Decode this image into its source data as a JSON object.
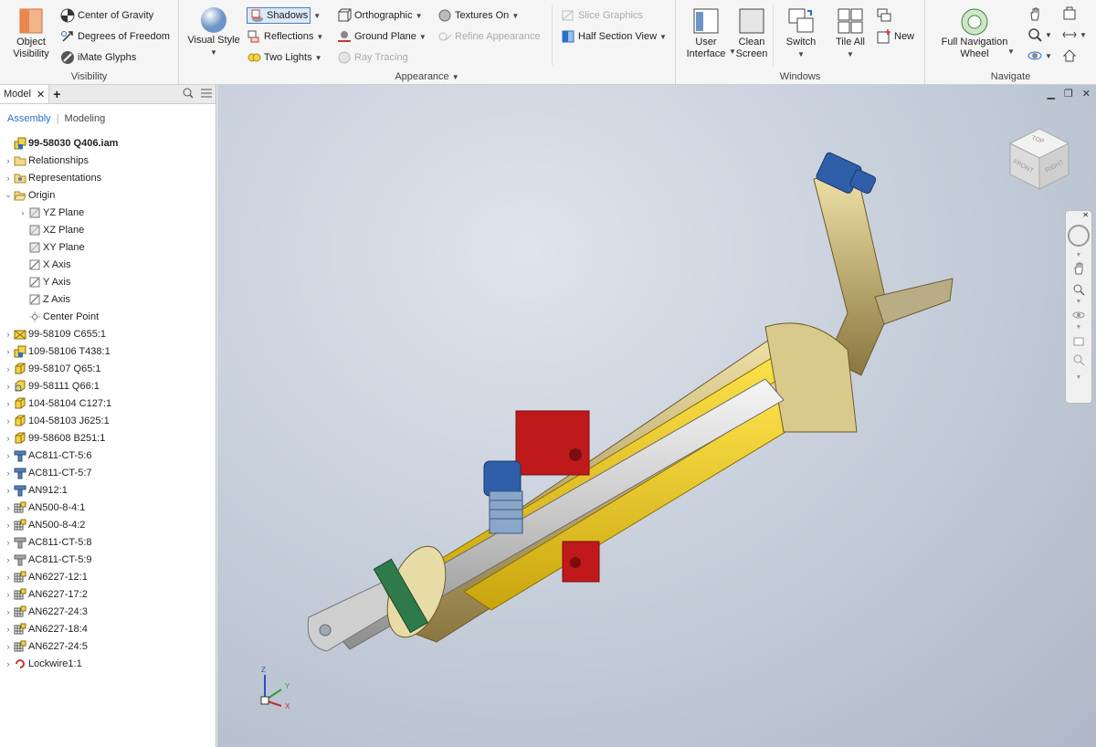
{
  "ribbon": {
    "visibility": {
      "object_visibility": "Object\nVisibility",
      "center_of_gravity": "Center of Gravity",
      "degrees_of_freedom": "Degrees of Freedom",
      "imate_glyphs": "iMate Glyphs",
      "label": "Visibility"
    },
    "appearance": {
      "visual_style": "Visual Style",
      "shadows": "Shadows",
      "reflections": "Reflections",
      "two_lights": "Two Lights",
      "orthographic": "Orthographic",
      "ground_plane": "Ground Plane",
      "ray_tracing": "Ray Tracing",
      "textures_on": "Textures On",
      "refine_appearance": "Refine Appearance",
      "slice_graphics": "Slice Graphics",
      "half_section_view": "Half Section View",
      "label": "Appearance"
    },
    "windows": {
      "user_interface": "User\nInterface",
      "clean_screen": "Clean\nScreen",
      "switch": "Switch",
      "tile_all": "Tile All",
      "new": "New",
      "label": "Windows"
    },
    "navigate": {
      "full_navigation_wheel": "Full Navigation\nWheel",
      "label": "Navigate"
    }
  },
  "browser": {
    "tab_model": "Model",
    "tab_add": "+",
    "sub_assembly": "Assembly",
    "sub_modeling": "Modeling",
    "items": [
      {
        "label": "99-58030 Q406.iam",
        "level": 0,
        "icon": "assembly",
        "bold": true,
        "twisty": ""
      },
      {
        "label": "Relationships",
        "level": 0,
        "icon": "folder",
        "twisty": ">"
      },
      {
        "label": "Representations",
        "level": 0,
        "icon": "folder-rep",
        "twisty": ">"
      },
      {
        "label": "Origin",
        "level": 0,
        "icon": "folder-open",
        "twisty": "v"
      },
      {
        "label": "YZ Plane",
        "level": 1,
        "icon": "plane",
        "twisty": ">"
      },
      {
        "label": "XZ Plane",
        "level": 1,
        "icon": "plane",
        "twisty": ""
      },
      {
        "label": "XY Plane",
        "level": 1,
        "icon": "plane",
        "twisty": ""
      },
      {
        "label": "X Axis",
        "level": 1,
        "icon": "axis",
        "twisty": ""
      },
      {
        "label": "Y Axis",
        "level": 1,
        "icon": "axis",
        "twisty": ""
      },
      {
        "label": "Z Axis",
        "level": 1,
        "icon": "axis",
        "twisty": ""
      },
      {
        "label": "Center Point",
        "level": 1,
        "icon": "point",
        "twisty": ""
      },
      {
        "label": "99-58109 C655:1",
        "level": 0,
        "icon": "subasm",
        "twisty": ">"
      },
      {
        "label": "109-58106 T438:1",
        "level": 0,
        "icon": "assembly",
        "twisty": ">"
      },
      {
        "label": "99-58107 Q65:1",
        "level": 0,
        "icon": "part",
        "twisty": ">"
      },
      {
        "label": "99-58111 Q66:1",
        "level": 0,
        "icon": "part-flex",
        "twisty": ">"
      },
      {
        "label": "104-58104 C127:1",
        "level": 0,
        "icon": "part",
        "twisty": ">"
      },
      {
        "label": "104-58103 J625:1",
        "level": 0,
        "icon": "part",
        "twisty": ">"
      },
      {
        "label": "99-58608 B251:1",
        "level": 0,
        "icon": "part",
        "twisty": ">"
      },
      {
        "label": "AC811-CT-5:6",
        "level": 0,
        "icon": "fitting",
        "twisty": ">"
      },
      {
        "label": "AC811-CT-5:7",
        "level": 0,
        "icon": "fitting",
        "twisty": ">"
      },
      {
        "label": "AN912:1",
        "level": 0,
        "icon": "fitting",
        "twisty": ">"
      },
      {
        "label": "AN500-8-4:1",
        "level": 0,
        "icon": "bolt",
        "twisty": ">"
      },
      {
        "label": "AN500-8-4:2",
        "level": 0,
        "icon": "bolt",
        "twisty": ">"
      },
      {
        "label": "AC811-CT-5:8",
        "level": 0,
        "icon": "fitting-grey",
        "twisty": ">"
      },
      {
        "label": "AC811-CT-5:9",
        "level": 0,
        "icon": "fitting-grey",
        "twisty": ">"
      },
      {
        "label": "AN6227-12:1",
        "level": 0,
        "icon": "bolt",
        "twisty": ">"
      },
      {
        "label": "AN6227-17:2",
        "level": 0,
        "icon": "bolt",
        "twisty": ">"
      },
      {
        "label": "AN6227-24:3",
        "level": 0,
        "icon": "bolt",
        "twisty": ">"
      },
      {
        "label": "AN6227-18:4",
        "level": 0,
        "icon": "bolt",
        "twisty": ">"
      },
      {
        "label": "AN6227-24:5",
        "level": 0,
        "icon": "bolt",
        "twisty": ">"
      },
      {
        "label": "Lockwire1:1",
        "level": 0,
        "icon": "lockwire",
        "twisty": ">"
      }
    ]
  },
  "viewcube": {
    "top": "TOP",
    "front": "FRONT",
    "right": "RIGHT"
  },
  "triad": {
    "x": "X",
    "y": "Y",
    "z": "Z"
  },
  "colors": {
    "accent": "#2a6fc9",
    "part_yellow": "#e8c21a",
    "fitting_blue": "#2f5fa8",
    "bracket_red": "#c0191b"
  }
}
